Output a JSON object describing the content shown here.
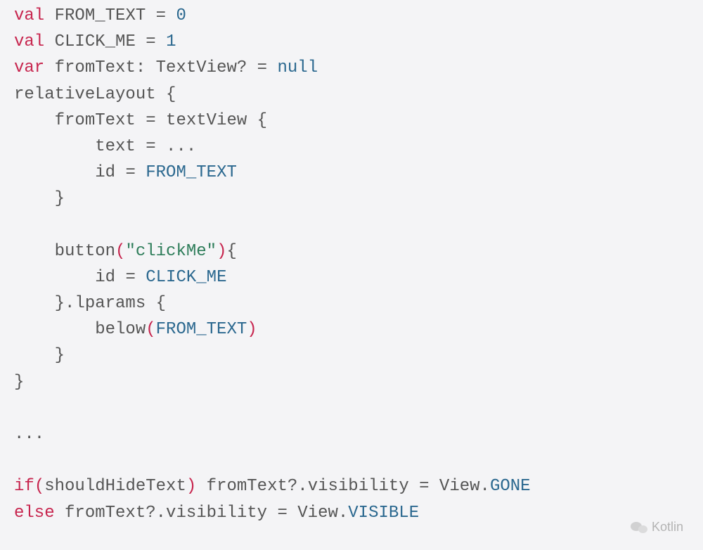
{
  "code": {
    "l1_val": "val",
    "l1_name": " FROM_TEXT ",
    "l1_eq": "= ",
    "l1_num": "0",
    "l2_val": "val",
    "l2_name": " CLICK_ME ",
    "l2_eq": "= ",
    "l2_num": "1",
    "l3_var": "var",
    "l3_name": " fromText",
    "l3_colon": ": ",
    "l3_type": "TextView",
    "l3_q": "? = ",
    "l3_null": "null",
    "l4_fn": "relativeLayout ",
    "l4_brace": "{",
    "l5_indent": "    ",
    "l5_lhs": "fromText ",
    "l5_eq": "= ",
    "l5_fn": "textView ",
    "l5_brace": "{",
    "l6_indent": "        ",
    "l6_lhs": "text ",
    "l6_eq": "= ...",
    "l7_indent": "        ",
    "l7_lhs": "id ",
    "l7_eq": "= ",
    "l7_const": "FROM_TEXT",
    "l8_indent": "    ",
    "l8_brace": "}",
    "l9": "",
    "l10_indent": "    ",
    "l10_fn": "button",
    "l10_lp": "(",
    "l10_str": "\"clickMe\"",
    "l10_rp": ")",
    "l10_brace": "{",
    "l11_indent": "        ",
    "l11_lhs": "id ",
    "l11_eq": "= ",
    "l11_const": "CLICK_ME",
    "l12_indent": "    ",
    "l12_close": "}",
    "l12_dot": ".",
    "l12_lparams": "lparams ",
    "l12_brace": "{",
    "l13_indent": "        ",
    "l13_fn": "below",
    "l13_lp": "(",
    "l13_const": "FROM_TEXT",
    "l13_rp": ")",
    "l14_indent": "    ",
    "l14_brace": "}",
    "l15_brace": "}",
    "l16": "",
    "l17_dots": "...",
    "l18": "",
    "l19_if": "if",
    "l19_lp": "(",
    "l19_cond": "shouldHideText",
    "l19_rp": ") ",
    "l19_hide": "fromText?.visibility = View.",
    "l19_gone": "GONE",
    "l20_else": "else",
    "l20_sp": " ",
    "l20_show": "fromText?.visibility = View.",
    "l20_visible": "VISIBLE"
  },
  "watermark": "Kotlin"
}
